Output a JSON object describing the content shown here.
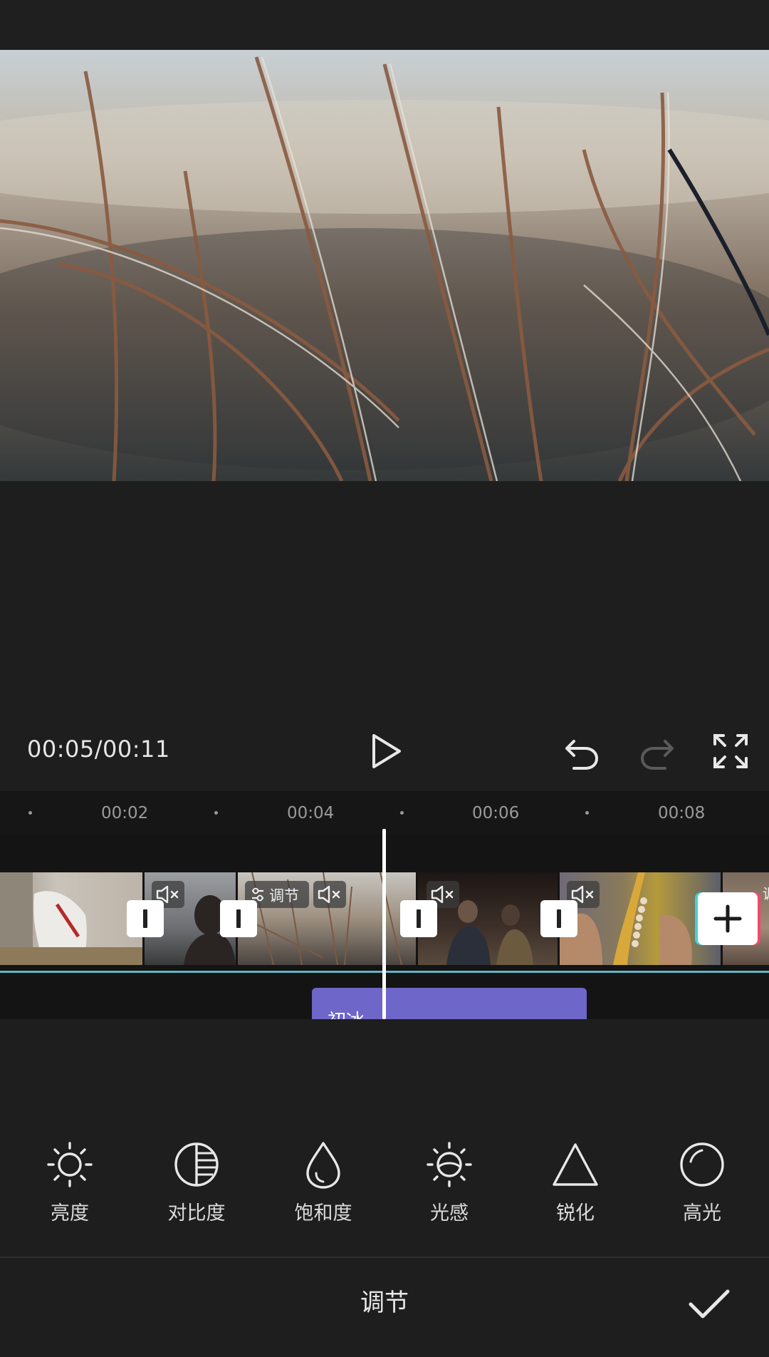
{
  "player": {
    "time_readout": "00:05/00:11"
  },
  "timeline": {
    "ticks": [
      "00:02",
      "00:04",
      "00:06",
      "00:08"
    ],
    "clip_tag_label": "调节",
    "cut_off_tag": "调",
    "filter_label": "初冰"
  },
  "tools": [
    {
      "label": "亮度",
      "icon": "sun-icon"
    },
    {
      "label": "对比度",
      "icon": "contrast-icon"
    },
    {
      "label": "饱和度",
      "icon": "droplet-icon"
    },
    {
      "label": "光感",
      "icon": "light-sense-icon"
    },
    {
      "label": "锐化",
      "icon": "triangle-icon"
    },
    {
      "label": "高光",
      "icon": "highlight-circle-icon"
    }
  ],
  "bottom_bar": {
    "title": "调节"
  },
  "colors": {
    "background": "#1e1e1e",
    "filter_purple": "#6e66c8",
    "track_line": "#5fb6c4"
  }
}
